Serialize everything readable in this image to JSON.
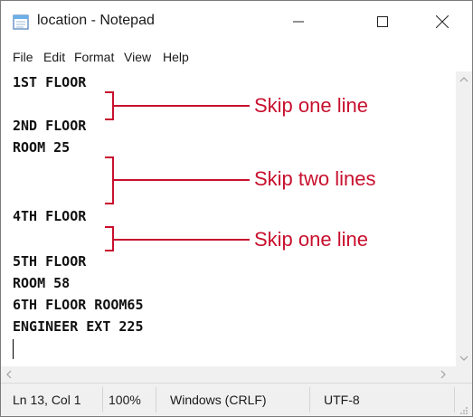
{
  "window": {
    "title": "location - Notepad"
  },
  "menu": [
    "File",
    "Edit",
    "Format",
    "View",
    "Help"
  ],
  "editor": {
    "lines": [
      "1ST FLOOR",
      "",
      "2ND FLOOR",
      "ROOM 25",
      "",
      "",
      "4TH FLOOR",
      "",
      "5TH FLOOR",
      "ROOM 58",
      "6TH FLOOR ROOM65",
      "ENGINEER EXT 225",
      ""
    ]
  },
  "annotations": [
    "Skip one line",
    "Skip two lines",
    "Skip one line"
  ],
  "annotation_color": "#c8102e",
  "status": {
    "position": "Ln 13, Col 1",
    "zoom": "100%",
    "line_ending": "Windows (CRLF)",
    "encoding": "UTF-8"
  },
  "icons": [
    "notepad-icon",
    "minimize-icon",
    "maximize-icon",
    "close-icon",
    "scroll-up-icon",
    "scroll-down-icon",
    "scroll-left-icon",
    "scroll-right-icon",
    "resize-grip-icon"
  ]
}
